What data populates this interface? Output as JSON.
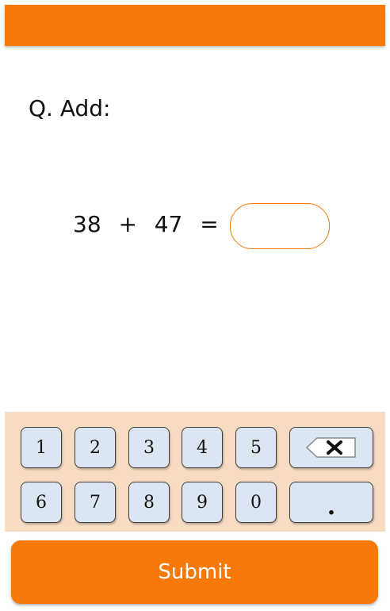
{
  "colors": {
    "accent": "#f7790a",
    "keypad_background": "#f8dcc2",
    "key_background": "#dce6f2"
  },
  "question": {
    "prompt": "Q. Add:",
    "operand_a": "38",
    "operator": "+",
    "operand_b": "47",
    "equals": "="
  },
  "answer": {
    "value": "",
    "placeholder": ""
  },
  "keypad": {
    "row1": [
      "1",
      "2",
      "3",
      "4",
      "5"
    ],
    "row2": [
      "6",
      "7",
      "8",
      "9",
      "0"
    ],
    "backspace_icon": "backspace-icon",
    "decimal_label": "."
  },
  "submit_label": "Submit"
}
